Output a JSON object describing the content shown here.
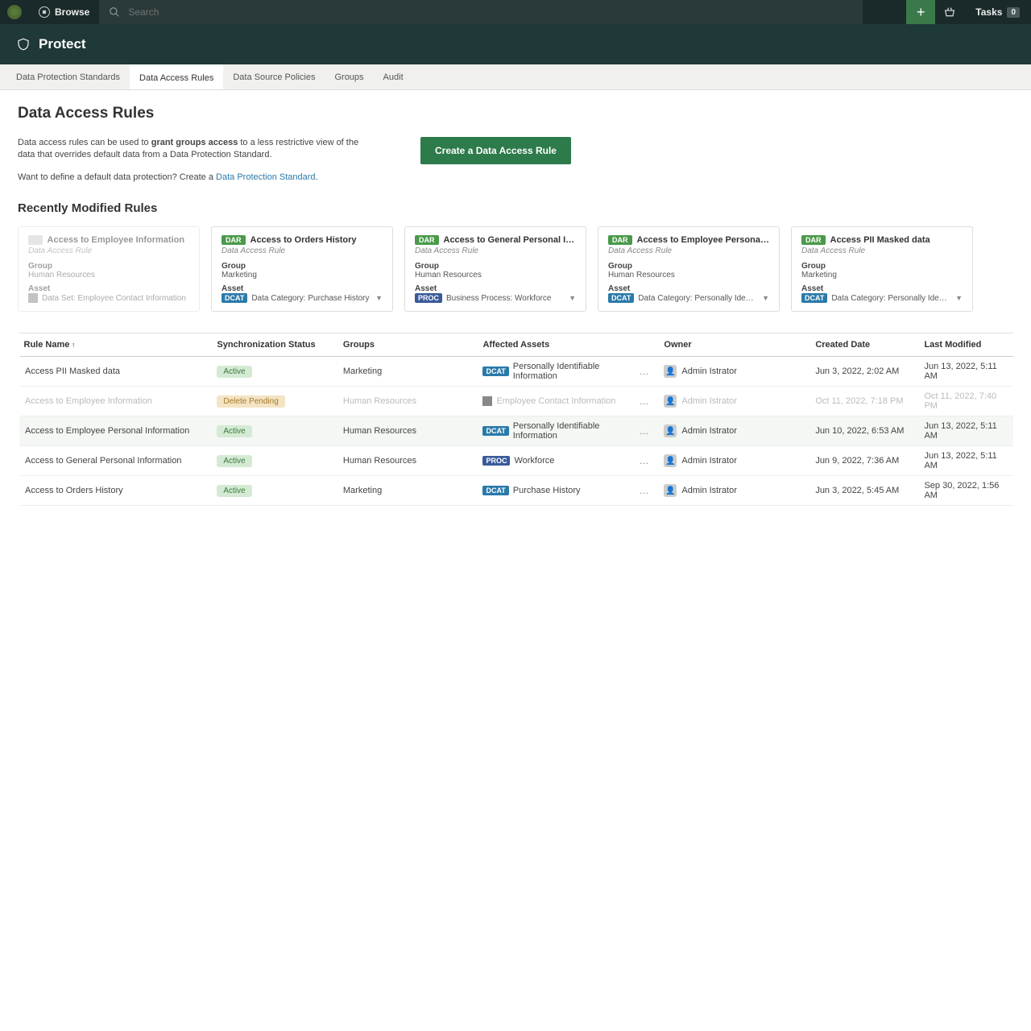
{
  "topbar": {
    "browse": "Browse",
    "search_placeholder": "Search",
    "tasks_label": "Tasks",
    "tasks_count": "0"
  },
  "subheader": {
    "title": "Protect"
  },
  "tabs": [
    "Data Protection Standards",
    "Data Access Rules",
    "Data Source Policies",
    "Groups",
    "Audit"
  ],
  "active_tab": 1,
  "page": {
    "title": "Data Access Rules",
    "intro_pre": "Data access rules can be used to ",
    "intro_bold": "grant groups access",
    "intro_post": " to a less restrictive view of the data that overrides default data from a Data Protection Standard.",
    "cta": "Create a Data Access Rule",
    "sub_intro_pre": "Want to define a default data protection? Create a ",
    "sub_intro_link": "Data Protection Standard",
    "sub_intro_post": "."
  },
  "recent": {
    "title": "Recently Modified Rules",
    "cards": [
      {
        "badge": "",
        "badge_grey": true,
        "title": "Access to Employee Information",
        "subtitle": "Data Access Rule",
        "group": "Human Resources",
        "asset_tag": "dset",
        "asset_text": "Data Set: Employee Contact Information",
        "disabled": true
      },
      {
        "badge": "DAR",
        "title": "Access to Orders History",
        "subtitle": "Data Access Rule",
        "group": "Marketing",
        "asset_tag": "dcat",
        "asset_text": "Data Category: Purchase History",
        "chevron": true
      },
      {
        "badge": "DAR",
        "title": "Access to General Personal Inf…",
        "subtitle": "Data Access Rule",
        "group": "Human Resources",
        "asset_tag": "proc",
        "asset_text": "Business Process: Workforce",
        "chevron": true
      },
      {
        "badge": "DAR",
        "title": "Access to Employee Personal I…",
        "subtitle": "Data Access Rule",
        "group": "Human Resources",
        "asset_tag": "dcat",
        "asset_text": "Data Category: Personally Identifi…",
        "chevron": true
      },
      {
        "badge": "DAR",
        "title": "Access PII Masked data",
        "subtitle": "Data Access Rule",
        "group": "Marketing",
        "asset_tag": "dcat",
        "asset_text": "Data Category: Personally Identifi…",
        "chevron": true
      }
    ]
  },
  "table": {
    "headers": {
      "rule": "Rule Name",
      "sync": "Synchronization Status",
      "groups": "Groups",
      "assets": "Affected Assets",
      "owner": "Owner",
      "created": "Created Date",
      "modified": "Last Modified"
    },
    "rows": [
      {
        "rule": "Access PII Masked data",
        "status": "Active",
        "status_class": "active",
        "groups": "Marketing",
        "asset_tag": "DCAT",
        "asset_tag_class": "dcat",
        "asset": "Personally Identifiable Information",
        "owner": "Admin Istrator",
        "created": "Jun 3, 2022, 2:02 AM",
        "modified": "Jun 13, 2022, 5:11 AM",
        "dim": false
      },
      {
        "rule": "Access to Employee Information",
        "status": "Delete Pending",
        "status_class": "pending",
        "groups": "Human Resources",
        "asset_tag": "",
        "asset_tag_class": "dset",
        "asset": "Employee Contact Information",
        "owner": "Admin Istrator",
        "created": "Oct 11, 2022, 7:18 PM",
        "modified": "Oct 11, 2022, 7:40 PM",
        "dim": true
      },
      {
        "rule": "Access to Employee Personal Information",
        "status": "Active",
        "status_class": "active",
        "groups": "Human Resources",
        "asset_tag": "DCAT",
        "asset_tag_class": "dcat",
        "asset": "Personally Identifiable Information",
        "owner": "Admin Istrator",
        "created": "Jun 10, 2022, 6:53 AM",
        "modified": "Jun 13, 2022, 5:11 AM",
        "dim": false,
        "hover": true
      },
      {
        "rule": "Access to General Personal Information",
        "status": "Active",
        "status_class": "active",
        "groups": "Human Resources",
        "asset_tag": "PROC",
        "asset_tag_class": "proc",
        "asset": "Workforce",
        "owner": "Admin Istrator",
        "created": "Jun 9, 2022, 7:36 AM",
        "modified": "Jun 13, 2022, 5:11 AM",
        "dim": false
      },
      {
        "rule": "Access to Orders History",
        "status": "Active",
        "status_class": "active",
        "groups": "Marketing",
        "asset_tag": "DCAT",
        "asset_tag_class": "dcat",
        "asset": "Purchase History",
        "owner": "Admin Istrator",
        "created": "Jun 3, 2022, 5:45 AM",
        "modified": "Sep 30, 2022, 1:56 AM",
        "dim": false
      }
    ]
  }
}
